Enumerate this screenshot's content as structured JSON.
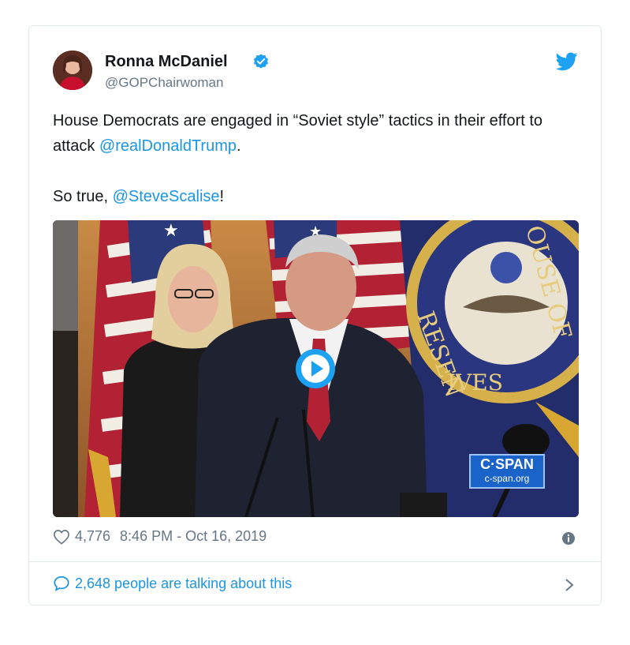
{
  "user": {
    "display_name": "Ronna McDaniel",
    "handle": "@GOPChairwoman"
  },
  "tweet": {
    "line1_text": "House Democrats are engaged in “Soviet style” tactics in their effort to attack ",
    "line1_mention": "@realDonaldTrump",
    "line1_end": ".",
    "line2_text": "So true, ",
    "line2_mention": "@SteveScalise",
    "line2_end": "!"
  },
  "media": {
    "watermark_title": "C·SPAN",
    "watermark_url": "c-span.org"
  },
  "meta": {
    "likes": "4,776",
    "timestamp": "8:46 PM - Oct 16, 2019"
  },
  "footer": {
    "talking_text": "2,648 people are talking about this"
  },
  "colors": {
    "link": "#1b95e0",
    "muted": "#657786",
    "text": "#14171a",
    "border": "#e1e8ed"
  }
}
